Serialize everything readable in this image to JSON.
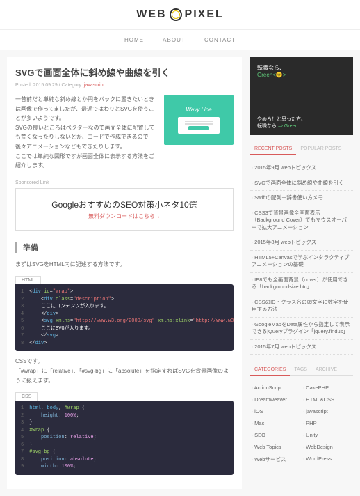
{
  "logo": {
    "left": "WEB",
    "right": "PIXEL"
  },
  "nav": [
    "HOME",
    "ABOUT",
    "CONTACT"
  ],
  "article": {
    "title": "SVGで画面全体に斜め線や曲線を引く",
    "meta_prefix": "Posted: 2015.09.29 / Category: ",
    "meta_cat": "javascript",
    "intro": "一昔前だと単純な斜め線とか円をバックに置きたいときは画像で作ってましたが、最近ではわりとSVGを使うことが多いようです。\nSVGの良いところはベクターなので画面全体に配置しても荒くなったりしないとか、コードで作成できるので後々アニメーションなどもできたりします。\nここでは単純な図形ですが画面全体に表示する方法をご紹介します。",
    "thumb_title": "Wavy Line",
    "sponsored": "Sponsored Link",
    "ad_title": "GoogleおすすめのSEO対策小ネタ10選",
    "ad_link": "無料ダウンロードはこちら→",
    "h2_1": "準備",
    "p1": "まずはSVGをHTML内に記述する方法です。",
    "code1_label": "HTML",
    "p2": "CSSです。\n「#wrap」に「relative」、「#svg-bg」に「absolute」を指定すればSVGを背景画像のように扱えます。",
    "code2_label": "CSS"
  },
  "sidebar": {
    "ad_line1": "転職なら、",
    "ad_line2": "Green<🙂>",
    "ad_line3": "やめろ！と思った方、",
    "ad_line4": "転職なら ⇒ Green",
    "tabs": [
      "RECENT POSTS",
      "POPULAR POSTS"
    ],
    "recent": [
      "2015年9月 webトピックス",
      "SVGで画面全体に斜め線や曲線を引く",
      "Swiftの配列＋辞書使い方メモ",
      "CSS3で背景画像全画面表示（Background Cover）でもマウスオーバーで拡大アニメーション",
      "2015年8月 webトピックス",
      "HTML5+Canvasで学ぶインタラクティブアニメーションの基礎",
      "IE8でも全画面背景（cover）が使用できる「backgroundsize.htc」",
      "CSSのID・クラス名の頭文字に数字を使用する方法",
      "GoogleMapをData属性から指定して表示できるjQueryプラグイン「jquery.findus」",
      "2015年7月 webトピックス"
    ],
    "cat_tabs": [
      "CATEGORIES",
      "TAGS",
      "ARCHIVE"
    ],
    "categories": [
      "ActionScript",
      "CakePHP",
      "Dreamweaver",
      "HTML&CSS",
      "iOS",
      "javascript",
      "Mac",
      "PHP",
      "SEO",
      "Unity",
      "Web Topics",
      "WebDesign",
      "Webサービス",
      "WordPress"
    ]
  }
}
